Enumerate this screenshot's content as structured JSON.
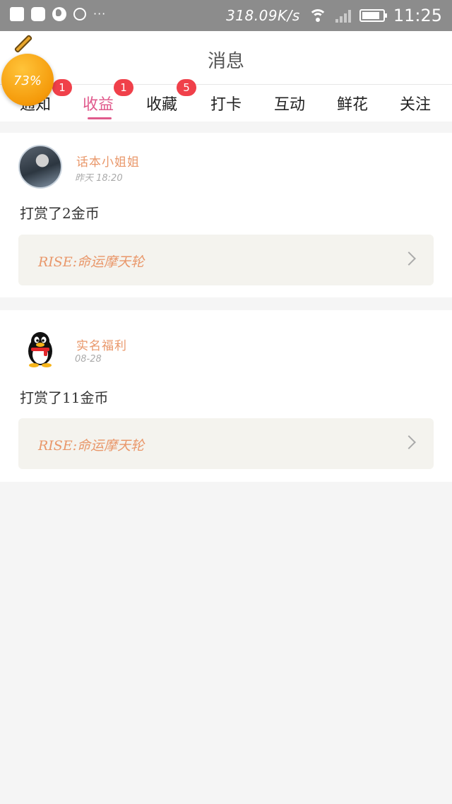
{
  "status_bar": {
    "speed": "318.09K/s",
    "time": "11:25",
    "icons": [
      "notification-square-icon",
      "notification-square-icon",
      "globe-icon",
      "sun-icon",
      "more-icon",
      "wifi-icon",
      "signal-icon",
      "battery-icon"
    ]
  },
  "header": {
    "title": "消息"
  },
  "float_ball": {
    "percent": "73%"
  },
  "tabs": [
    {
      "label": "通知",
      "badge": "1"
    },
    {
      "label": "收益",
      "badge": "1",
      "active": true
    },
    {
      "label": "收藏",
      "badge": "5"
    },
    {
      "label": "打卡"
    },
    {
      "label": "互动"
    },
    {
      "label": "鲜花"
    },
    {
      "label": "关注"
    }
  ],
  "messages": [
    {
      "username": "话本小姐姐",
      "time": "昨天 18:20",
      "text": "打赏了2金币",
      "link": "RISE:命运摩天轮",
      "avatar": "user-photo-avatar"
    },
    {
      "username": "实名福利",
      "time": "08-28",
      "text": "打赏了11金币",
      "link": "RISE:命运摩天轮",
      "avatar": "qq-penguin-avatar"
    }
  ],
  "colors": {
    "accent": "#e05a8c",
    "username": "#e9976a",
    "badge": "#f0404a",
    "status_bar": "#8c8c8c"
  }
}
